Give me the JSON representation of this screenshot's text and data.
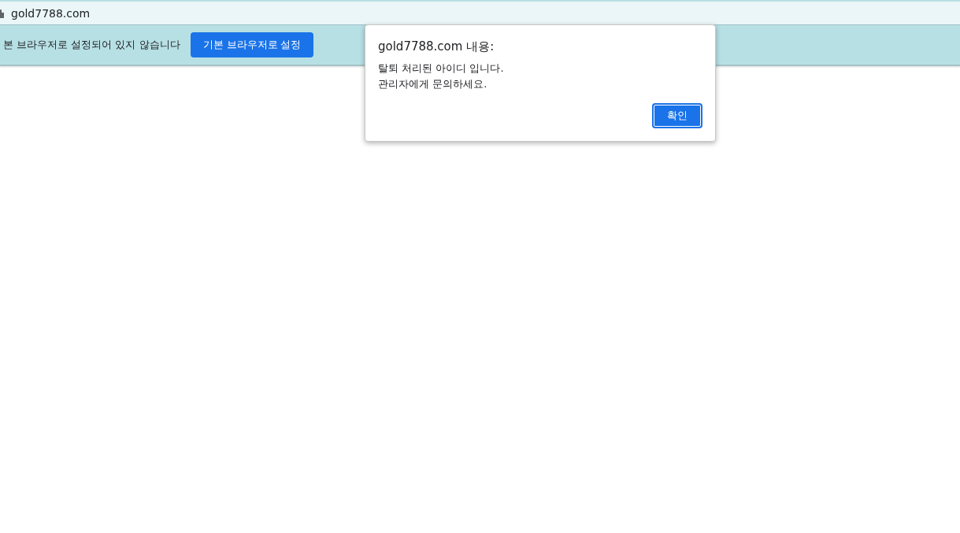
{
  "address_bar": {
    "url": "gold7788.com"
  },
  "info_bar": {
    "message": "본 브라우저로 설정되어 있지 않습니다",
    "button": "기본 브라우저로 설정"
  },
  "dialog": {
    "title": "gold7788.com 내용:",
    "lines": [
      "탈퇴 처리된 아이디 입니다.",
      "관리자에게 문의하세요."
    ],
    "button": "확인"
  }
}
